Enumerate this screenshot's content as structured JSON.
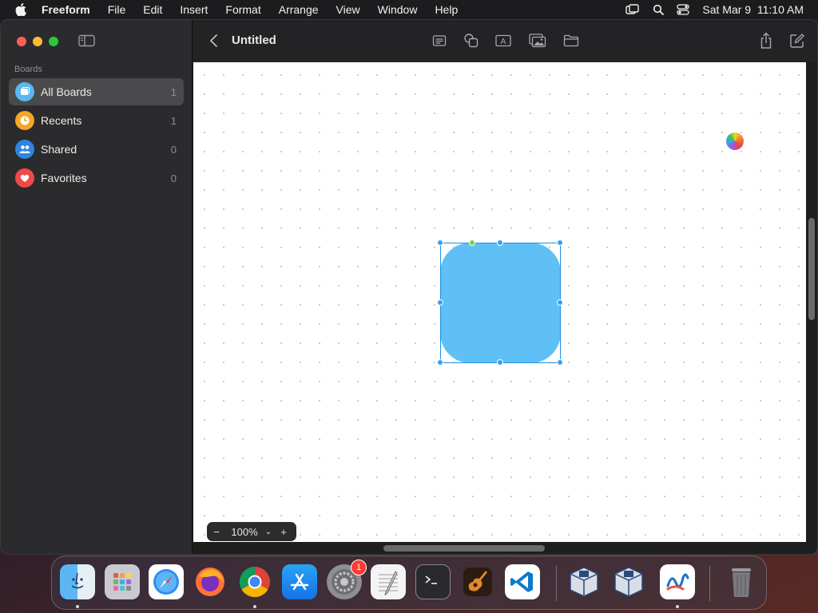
{
  "menubar": {
    "app_name": "Freeform",
    "items": [
      "File",
      "Edit",
      "Insert",
      "Format",
      "Arrange",
      "View",
      "Window",
      "Help"
    ],
    "datetime": "Sat Mar 9  11:10 AM"
  },
  "sidebar": {
    "section_title": "Boards",
    "items": [
      {
        "label": "All Boards",
        "count": "1",
        "icon": "boards-icon",
        "color": "#5ab8f0",
        "active": true
      },
      {
        "label": "Recents",
        "count": "1",
        "icon": "clock-icon",
        "color": "#f5a623",
        "active": false
      },
      {
        "label": "Shared",
        "count": "0",
        "icon": "people-icon",
        "color": "#2d86e0",
        "active": false
      },
      {
        "label": "Favorites",
        "count": "0",
        "icon": "heart-icon",
        "color": "#ef4a4a",
        "active": false
      }
    ]
  },
  "toolbar": {
    "title": "Untitled",
    "tools": [
      "sticky-note-icon",
      "shapes-icon",
      "text-box-icon",
      "media-icon",
      "folder-icon"
    ],
    "right_tools": [
      "share-icon",
      "compose-icon"
    ]
  },
  "canvas": {
    "shape_color": "#5ec0f5",
    "selection_color": "#1f8ee0"
  },
  "zoom": {
    "minus": "−",
    "value": "100%",
    "chevron": "⌄",
    "plus": "+"
  },
  "dock": {
    "apps": [
      {
        "name": "finder-icon",
        "running": true
      },
      {
        "name": "launchpad-icon",
        "running": false
      },
      {
        "name": "safari-icon",
        "running": false
      },
      {
        "name": "firefox-icon",
        "running": false
      },
      {
        "name": "chrome-icon",
        "running": true
      },
      {
        "name": "app-store-icon",
        "running": false
      },
      {
        "name": "system-settings-icon",
        "running": false,
        "badge": "1"
      },
      {
        "name": "textedit-icon",
        "running": false
      },
      {
        "name": "terminal-icon",
        "running": false
      },
      {
        "name": "garageband-icon",
        "running": false
      },
      {
        "name": "vscode-icon",
        "running": false
      },
      {
        "name": "virtualbox-icon",
        "running": false
      },
      {
        "name": "virtualbox-vm-icon",
        "running": false
      },
      {
        "name": "freeform-icon",
        "running": true
      },
      {
        "name": "trash-icon",
        "running": false
      }
    ]
  }
}
